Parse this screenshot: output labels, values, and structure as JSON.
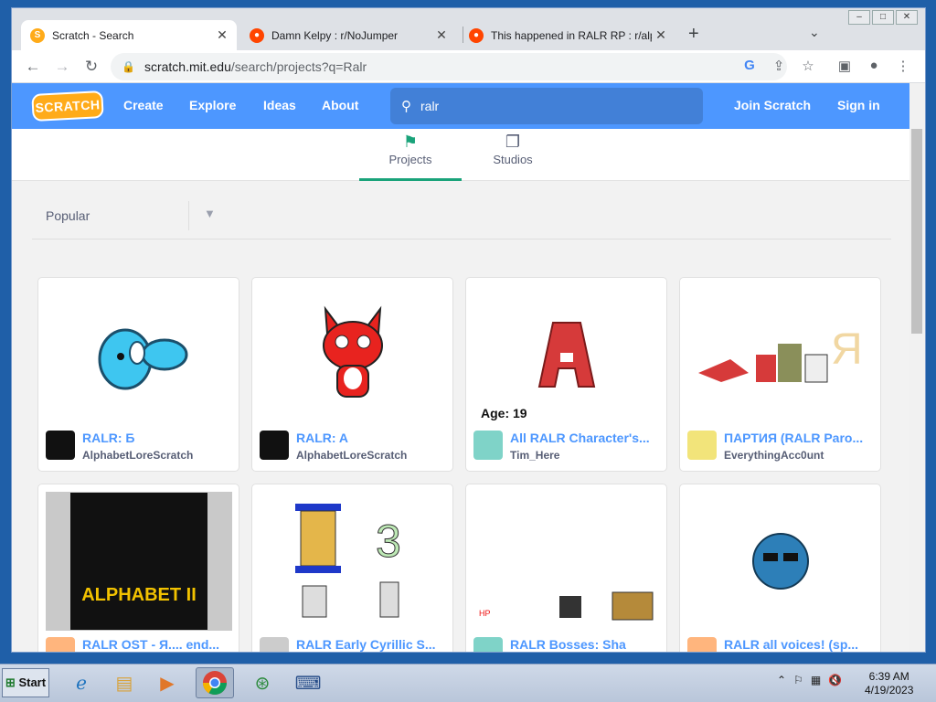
{
  "browser": {
    "tabs": [
      {
        "title": "Scratch - Search",
        "active": true,
        "favicon": "scratch-favicon"
      },
      {
        "title": "Damn Kelpy : r/NoJumper",
        "active": false,
        "favicon": "reddit-favicon"
      },
      {
        "title": "This happened in RALR RP : r/alphab",
        "active": false,
        "favicon": "reddit-favicon"
      }
    ],
    "url_host": "scratch.mit.edu",
    "url_path": "/search/projects?q=Ralr"
  },
  "scratch": {
    "logo": "SCRATCH",
    "nav": [
      "Create",
      "Explore",
      "Ideas",
      "About"
    ],
    "search_query": "ralr",
    "join": "Join Scratch",
    "signin": "Sign in",
    "tabs": [
      "Projects",
      "Studios"
    ],
    "sort": "Popular",
    "projects": [
      {
        "title": "RALR: Б",
        "author": "AlphabetLoreScratch"
      },
      {
        "title": "RALR: A",
        "author": "AlphabetLoreScratch"
      },
      {
        "title": "All RALR Character's...",
        "author": "Tim_Here",
        "thumb_text": "Age: 19"
      },
      {
        "title": "ПАРТИЯ (RALR Paro...",
        "author": "EverythingAcc0unt"
      },
      {
        "title": "RALR OST - Я.... end...",
        "author": "",
        "thumb_text": "ALPHABET II"
      },
      {
        "title": "RALR Early Cyrillic S...",
        "author": ""
      },
      {
        "title": "RALR Bosses: Sha",
        "author": ""
      },
      {
        "title": "RALR all voices! (sp...",
        "author": ""
      }
    ]
  },
  "taskbar": {
    "start": "Start",
    "time": "6:39 AM",
    "date": "4/19/2023"
  },
  "colors": {
    "scratch_blue": "#4d97ff",
    "scratch_green": "#1aa37a",
    "scratch_orange": "#ffab19"
  }
}
